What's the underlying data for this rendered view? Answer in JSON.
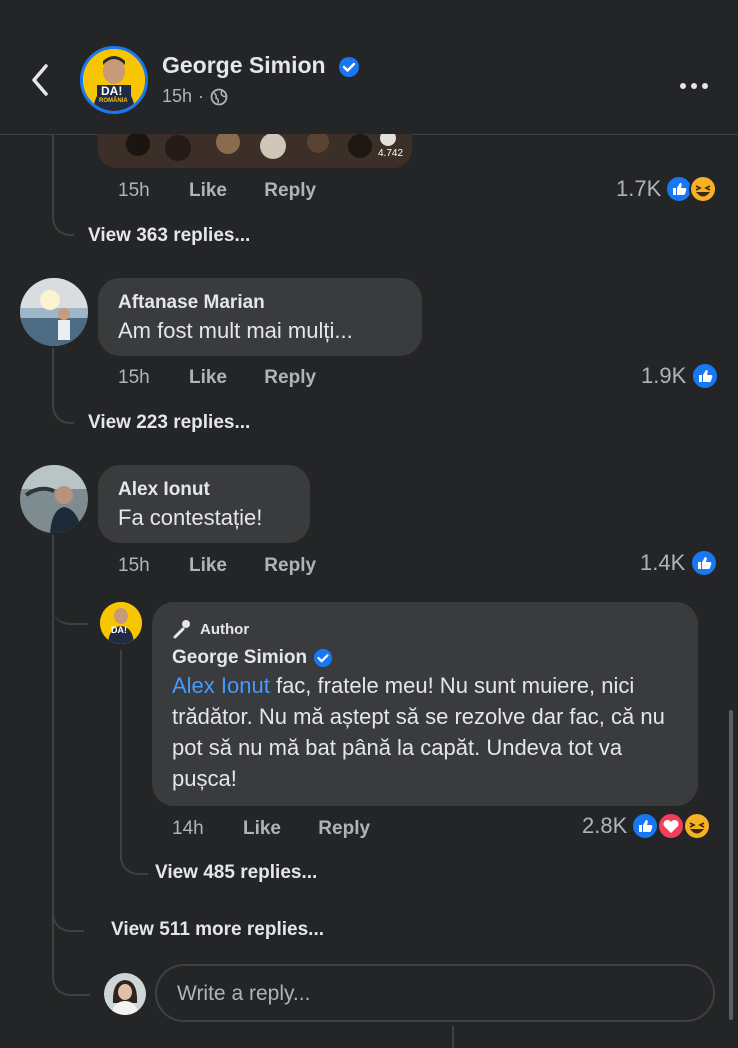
{
  "header": {
    "page_name": "George Simion",
    "time": "15h",
    "separator": "·",
    "avatar_text": "DA!",
    "avatar_subtext": "ROMÂNIA"
  },
  "thread": {
    "prev": {
      "time": "15h",
      "like": "Like",
      "reply": "Reply",
      "reactions": "1.7K",
      "media_count": "4.742",
      "view_replies": "View 363 replies..."
    },
    "comments": [
      {
        "name": "Aftanase Marian",
        "text": "Am fost mult mai mulți...",
        "time": "15h",
        "like": "Like",
        "reply": "Reply",
        "reactions": "1.9K",
        "view_replies": "View 223 replies..."
      },
      {
        "name": "Alex Ionut",
        "text": "Fa contestație!",
        "time": "15h",
        "like": "Like",
        "reply": "Reply",
        "reactions": "1.4K"
      }
    ],
    "author_reply": {
      "badge": "Author",
      "name": "George Simion",
      "mention": "Alex Ionut",
      "text": " fac, fratele meu! Nu sunt muiere, nici trădător. Nu mă aștept să se rezolve dar fac, că nu pot să nu mă bat până la capăt. Undeva tot va pușca!",
      "time": "14h",
      "like": "Like",
      "reply": "Reply",
      "reactions": "2.8K",
      "view_replies": "View 485 replies...",
      "avatar_text": "DA!"
    },
    "view_more": "View 511 more replies...",
    "reply_placeholder": "Write a reply..."
  },
  "colors": {
    "background": "#242526",
    "bubble": "#3a3b3c",
    "accent": "#1877f2",
    "mention": "#4599ff",
    "love": "#f33e58",
    "haha": "#f7b125"
  }
}
